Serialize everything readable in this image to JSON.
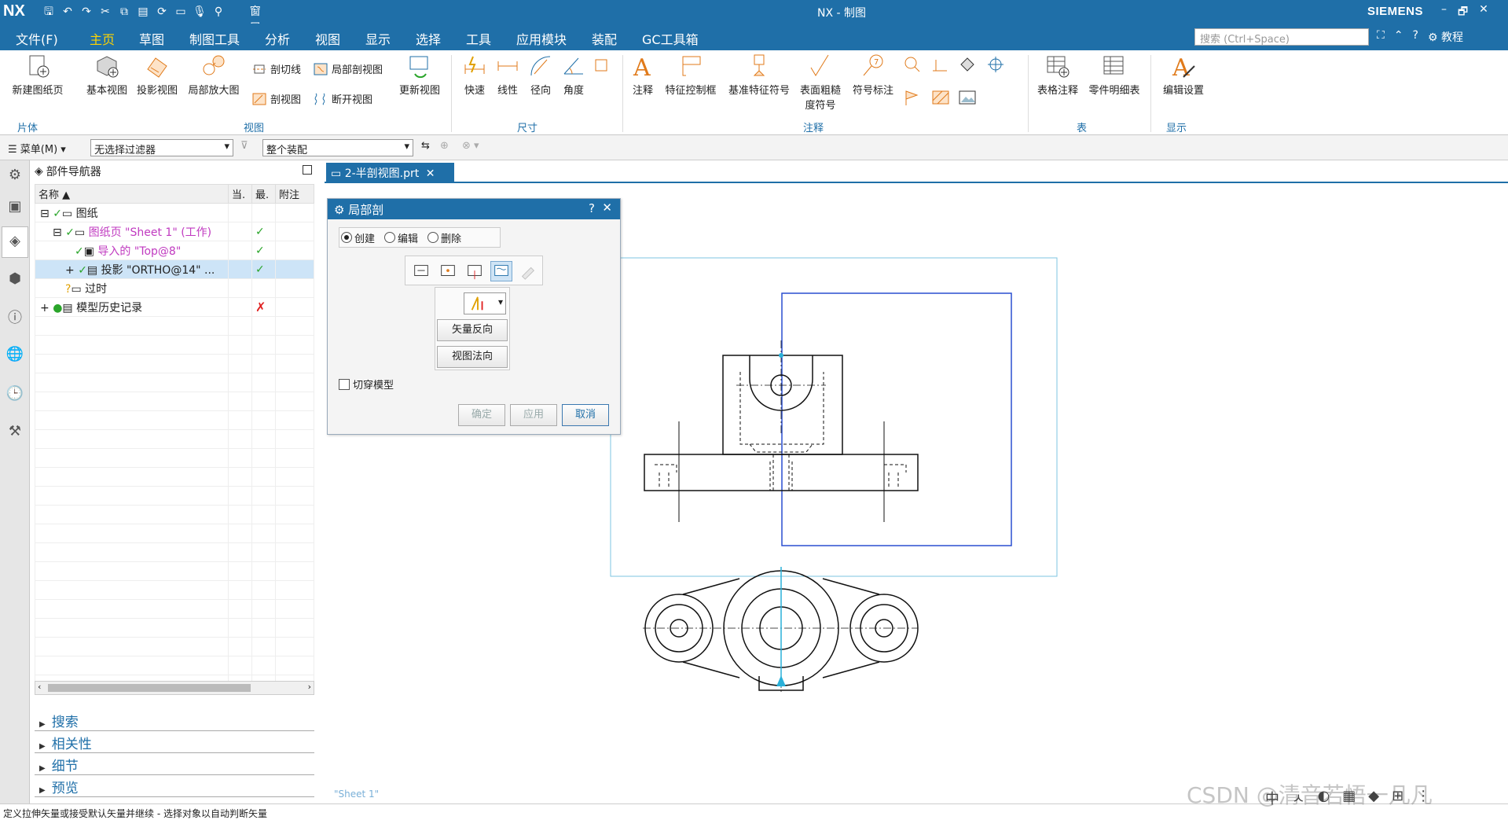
{
  "titlebar": {
    "logo": "NX",
    "title": "NX - 制图",
    "brand": "SIEMENS",
    "window_menu": "窗口",
    "controls": [
      "–",
      "🗗",
      "—",
      "✕"
    ]
  },
  "menubar": {
    "tabs": [
      "文件(F)",
      "主页",
      "草图",
      "制图工具",
      "分析",
      "视图",
      "显示",
      "选择",
      "工具",
      "应用模块",
      "装配",
      "GC工具箱"
    ],
    "active_tab": "主页",
    "search_placeholder": "搜索 (Ctrl+Space)",
    "tutorial": "教程"
  },
  "ribbon": {
    "new_sheet": "新建图纸页",
    "base_view": "基本视图",
    "projected_view": "投影视图",
    "detail_view": "局部放大图",
    "section_line": "剖切线",
    "section_view": "剖视图",
    "break_out_section": "局部剖视图",
    "broken_view": "断开视图",
    "update_view": "更新视图",
    "rapid": "快速",
    "linear": "线性",
    "radial": "径向",
    "angular": "角度",
    "note": "注释",
    "fcf": "特征控制框",
    "datum_symbol": "基准特征符号",
    "surface_finish_1": "表面粗糙",
    "surface_finish_2": "度符号",
    "balloon": "符号标注",
    "tabular_note": "表格注释",
    "parts_list": "零件明细表",
    "edit_settings": "编辑设置",
    "groups": {
      "sheet": "片体",
      "view": "视图",
      "dimension": "尺寸",
      "annotation": "注释",
      "table": "表",
      "display": "显示"
    }
  },
  "filterbar": {
    "menu": "菜单(M)",
    "filter": "无选择过滤器",
    "scope": "整个装配"
  },
  "navigator": {
    "title": "部件导航器",
    "columns": [
      "名称",
      "当.",
      "最.",
      "附注"
    ],
    "rows": [
      {
        "label": "图纸",
        "status": ""
      },
      {
        "label": "图纸页 \"Sheet 1\" (工作)",
        "status": "✓"
      },
      {
        "label": "导入的 \"Top@8\"",
        "status": "✓"
      },
      {
        "label": "投影 \"ORTHO@14\" ...",
        "status": "✓"
      },
      {
        "label": "过时",
        "status": ""
      },
      {
        "label": "模型历史记录",
        "status": "✗"
      }
    ],
    "sections": [
      "搜索",
      "相关性",
      "细节",
      "预览"
    ]
  },
  "document_tab": "2-半剖视图.prt",
  "sheet_label": "\"Sheet 1\"",
  "dialog": {
    "title": "局部剖",
    "help": "?",
    "modes": [
      "创建",
      "编辑",
      "删除"
    ],
    "selected_mode": "创建",
    "reverse_vector": "矢量反向",
    "view_normal": "视图法向",
    "cut_through": "切穿模型",
    "ok": "确定",
    "apply": "应用",
    "cancel": "取消"
  },
  "status": "定义拉伸矢量或接受默认矢量并继续 - 选择对象以自动判断矢量",
  "watermark": "CSDN @清音若悟一凡凡",
  "ime": [
    "中",
    "ㅅ",
    "◐",
    "▦",
    "◆",
    "⊞",
    "⋮"
  ]
}
